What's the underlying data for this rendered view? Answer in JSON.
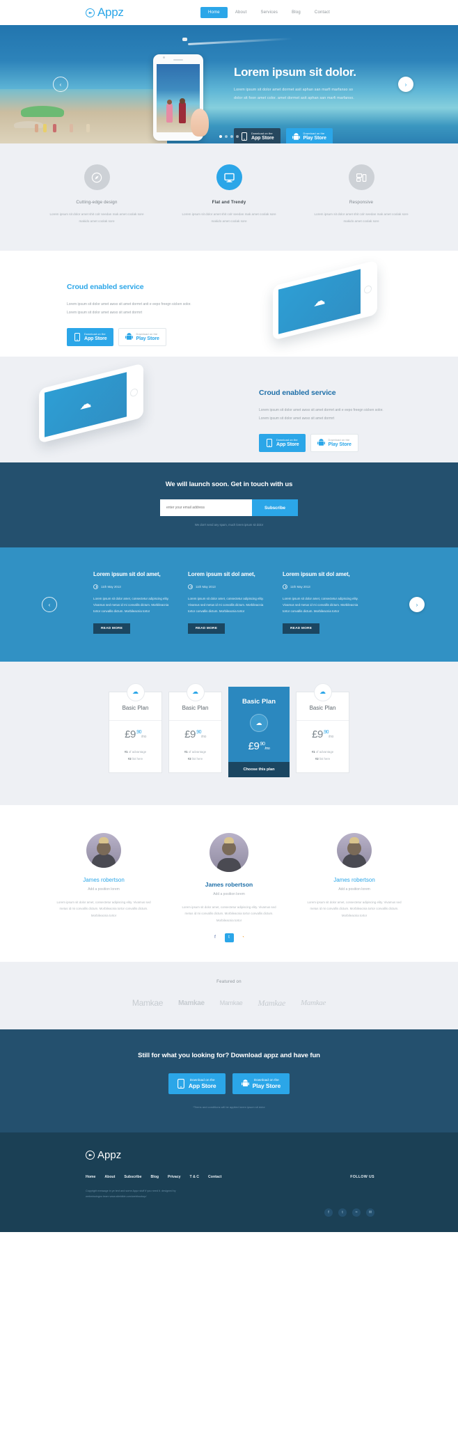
{
  "header": {
    "logo_text": "Appz",
    "nav": [
      {
        "label": "Home",
        "active": true
      },
      {
        "label": "About",
        "active": false
      },
      {
        "label": "Services",
        "active": false
      },
      {
        "label": "Blog",
        "active": false
      },
      {
        "label": "Contact",
        "active": false
      }
    ]
  },
  "hero": {
    "title": "Lorem ipsum sit dolor.",
    "paragraph": "Lorem ipsum sit dolor amet dormet asit aphan san marfi marfanso so dolor sit foon amet color. amet dormet asit aphan san marfi marfanso.",
    "appstore": {
      "top": "Download on the",
      "main": "App Store"
    },
    "playstore": {
      "top": "Download on the",
      "main": "Play Store"
    },
    "prev_arrow": "‹",
    "next_arrow": "›",
    "dots": 4,
    "active_dot": 1
  },
  "features": {
    "items": [
      {
        "title": "Cutting-edge design",
        "desc": "Lorem ipsum sit dolor amet shit colr seedan mak amet coolak sore makido amet coolak sore",
        "icon": "compass-icon",
        "active": false
      },
      {
        "title": "Flat and Trendy",
        "desc": "Lorem ipsum sit dolor amet shit colr seedan mak amet coolak sore makido amet coolak sore",
        "icon": "monitor-icon",
        "active": true
      },
      {
        "title": "Responsive",
        "desc": "Lorem ipsum sit dolor amet shit colr seedan mak amet coolak sore makido amet coolak sore",
        "icon": "devices-icon",
        "active": false
      }
    ]
  },
  "cloud_section_1": {
    "title": "Croud enabled service",
    "paragraph": "Lorem ipsum sit dolor amet awso sit amet dormrt anit e eepo freegn sicken solor. Lorem ipsum sit dolor amet awso sit amet dormrt",
    "appstore": {
      "top": "Download on the",
      "main": "App Store"
    },
    "playstore": {
      "top": "Download on the",
      "main": "Play Store"
    }
  },
  "cloud_section_2": {
    "title": "Croud enabled service",
    "paragraph": "Lorem ipsum sit dolor amet awso sit amet dormrt anit e eepo freegn sicken solor. Lorem ipsum sit dolor amet awso sit amet dormrt",
    "appstore": {
      "top": "Download on the",
      "main": "App Store"
    },
    "playstore": {
      "top": "Download on the",
      "main": "Play Store"
    }
  },
  "newsletter": {
    "heading": "We will launch soon. Get in touch with us",
    "input_placeholder": "enter your email address",
    "input_value": "",
    "button_label": "Subscribe",
    "note": "We don't send any spam, much lorem ipsum sit dolor"
  },
  "blog": {
    "posts": [
      {
        "title": "Lorem ipsum sit dol amet,",
        "date": "11th May 2013",
        "excerpt": "Lorem ipsum sit dolor amet, consectetur adipiscing elity. Vivamus sed metus id mi convallis dictum. Morbileacnia tortor convallis dictum. Morbileacnia tortor",
        "read_more": "READ MORE"
      },
      {
        "title": "Lorem ipsum sit dol amet,",
        "date": "11th May 2013",
        "excerpt": "Lorem ipsum sit dolor amet, consectetur adipiscing elity. Vivamus sed metus id mi convallis dictum. Morbileacnia tortor convallis dictum. Morbileacnia tortor",
        "read_more": "READ MORE"
      },
      {
        "title": "Lorem ipsum sit dol amet,",
        "date": "11th May 2013",
        "excerpt": "Lorem ipsum sit dolor amet, consectetur adipiscing elity. Vivamus sed metus id mi convallis dictum. Morbileacnia tortor convallis dictum. Morbileacnia tortor",
        "read_more": "READ MORE"
      }
    ],
    "prev_arrow": "‹",
    "next_arrow": "›"
  },
  "pricing": {
    "plans": [
      {
        "name": "Basic Plan",
        "currency": "£9",
        "cents": ".90",
        "period": "/mo",
        "feat1_num": "#1",
        "feat1_text": " of advantage",
        "feat2_num": "#2",
        "feat2_text": " list here",
        "featured": false
      },
      {
        "name": "Basic Plan",
        "currency": "£9",
        "cents": ".90",
        "period": "/mo",
        "feat1_num": "#1",
        "feat1_text": " of advantage",
        "feat2_num": "#2",
        "feat2_text": " list here",
        "featured": false
      },
      {
        "name": "Basic Plan",
        "currency": "£9",
        "cents": ".90",
        "period": "/mo",
        "button_label": "Choose this plan",
        "featured": true
      },
      {
        "name": "Basic Plan",
        "currency": "£9",
        "cents": ".90",
        "period": "/mo",
        "feat1_num": "#1",
        "feat1_text": " of advantage",
        "feat2_num": "#2",
        "feat2_text": " list here",
        "featured": false
      }
    ]
  },
  "team": {
    "members": [
      {
        "name": "James robertson",
        "role": "Add a position lorem",
        "desc": "Lorem ipsum sit dolor amet, consectetur adipiscing elity. Vivamus sed metus id mi convallis dictum. Morbileacnia tortor convallis dictum. Morbileacnia tortor",
        "featured": false
      },
      {
        "name": "James robertson",
        "role": "Add a position lorem",
        "desc": "Lorem ipsum sit dolor amet, consectetur adipiscing elity. Vivamus sed metus id mi convallis dictum. Morbileacnia tortor convallis dictum. Morbileacnia tortor",
        "featured": true
      },
      {
        "name": "James robertson",
        "role": "Add a position lorem",
        "desc": "Lorem ipsum sit dolor amet, consectetur adipiscing elity. Vivamus sed metus id mi convallis dictum. Morbileacnia tortor convallis dictum. Morbileacnia tortor",
        "featured": false
      }
    ],
    "socials": [
      {
        "name": "facebook-icon",
        "glyph": "f"
      },
      {
        "name": "twitter-icon",
        "glyph": "t"
      },
      {
        "name": "rss-icon",
        "glyph": "◔"
      }
    ]
  },
  "featured_on": {
    "title": "Featured on",
    "logos": [
      "Mamkae",
      "Mamkae",
      "Mamkae",
      "Mamkae",
      "Mamkae"
    ]
  },
  "cta": {
    "heading": "Still for what you looking for? Download appz and have fun",
    "appstore": {
      "top": "Download on the",
      "main": "App Store"
    },
    "playstore": {
      "top": "Download on the",
      "main": "Play Store"
    },
    "note": "*Terms and conditions will be applied lorem ipsum sit dolor"
  },
  "footer": {
    "logo_text": "Appz",
    "nav": [
      "Home",
      "About",
      "Subscribe",
      "Blog",
      "Privacy",
      "T & C",
      "Contact"
    ],
    "follow_label": "FOLLOW US",
    "copyright": "Copyright message in ye text and some Appz stuff if you need it. designed by webmissingno team www.sitebible.com/webhookup/",
    "socials": [
      {
        "name": "facebook-icon",
        "glyph": "f"
      },
      {
        "name": "twitter-icon",
        "glyph": "t"
      },
      {
        "name": "rss-icon",
        "glyph": "≈"
      },
      {
        "name": "email-icon",
        "glyph": "✉"
      }
    ]
  },
  "colors": {
    "accent": "#2ba6e8",
    "dark_blue": "#24506e",
    "footer": "#1b4055",
    "blog_blue": "#3191c4",
    "light_bg": "#eef0f4"
  }
}
